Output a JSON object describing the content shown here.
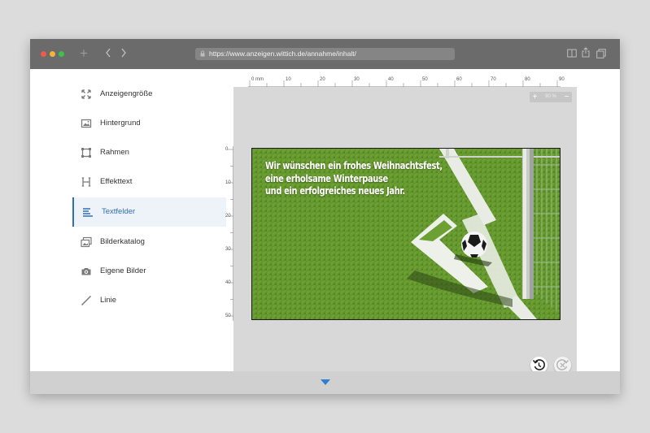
{
  "browser": {
    "url": "https://www.anzeigen.wittich.de/annahme/inhalt/",
    "icons": [
      "plus-icon",
      "back-icon",
      "forward-icon",
      "lock-icon",
      "reader-icon",
      "share-icon",
      "tabs-icon"
    ]
  },
  "sidebar": {
    "items": [
      {
        "label": "Anzeigengröße",
        "icon": "resize-icon"
      },
      {
        "label": "Hintergrund",
        "icon": "image-icon"
      },
      {
        "label": "Rahmen",
        "icon": "frame-icon"
      },
      {
        "label": "Effekttext",
        "icon": "effect-text-icon"
      },
      {
        "label": "Textfelder",
        "icon": "text-fields-icon",
        "active": true
      },
      {
        "label": "Bilderkatalog",
        "icon": "catalog-icon"
      },
      {
        "label": "Eigene Bilder",
        "icon": "camera-icon"
      },
      {
        "label": "Linie",
        "icon": "line-icon"
      }
    ],
    "active_color": "#2f6fb4"
  },
  "ruler": {
    "horizontal": [
      "0 mm",
      "10",
      "20",
      "30",
      "40",
      "50",
      "60",
      "70",
      "80",
      "90"
    ],
    "vertical": [
      "0",
      "10",
      "20",
      "30",
      "40",
      "50"
    ]
  },
  "zoom": {
    "plus": "+",
    "value": "90 %",
    "minus": "−"
  },
  "ad": {
    "lines": [
      "Wir wünschen ein frohes Weihnachtsfest,",
      "eine erholsame Winterpause",
      "und ein erfolgreiches neues Jahr."
    ]
  },
  "footer": {
    "toggle_icon": "chevron-down-icon"
  }
}
